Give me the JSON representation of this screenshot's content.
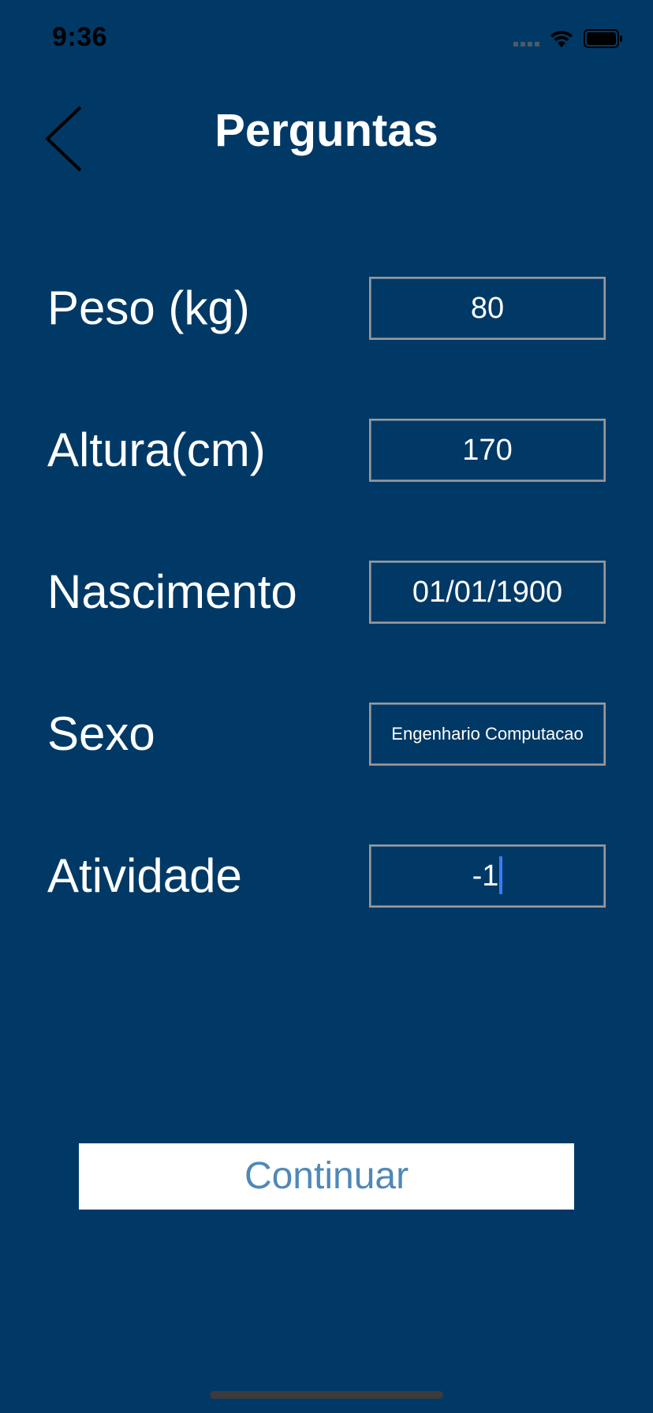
{
  "status_bar": {
    "time": "9:36",
    "icons": [
      "cellular-signal-icon",
      "wifi-icon",
      "battery-icon"
    ]
  },
  "nav": {
    "back_icon": "chevron-left-icon",
    "title": "Perguntas"
  },
  "form": {
    "weight": {
      "label": "Peso (kg)",
      "value": "80"
    },
    "height": {
      "label": "Altura(cm)",
      "value": "170"
    },
    "birth": {
      "label": "Nascimento",
      "value": "01/01/1900"
    },
    "sex": {
      "label": "Sexo",
      "value": "Engenhario Computacao"
    },
    "activity": {
      "label": "Atividade",
      "value": "-1"
    }
  },
  "actions": {
    "continue_label": "Continuar"
  },
  "colors": {
    "background": "#013966",
    "field_border": "#9a9a9a",
    "button_bg": "#ffffff",
    "button_text": "#4f88b8",
    "caret": "#3d7af7"
  }
}
